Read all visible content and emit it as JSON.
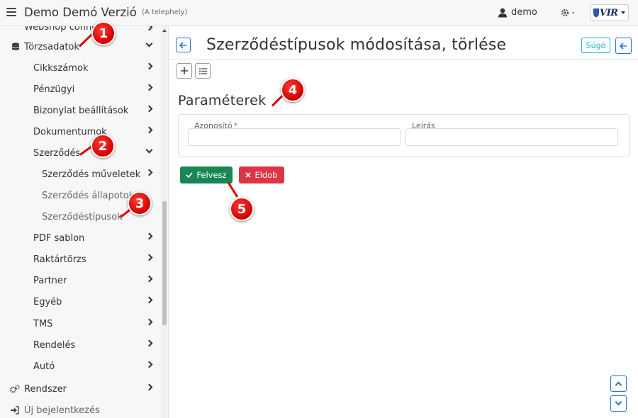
{
  "header": {
    "app_title": "Demo Demó Verzió",
    "location": "(A telephely)",
    "user": "demo",
    "logo_text": "VIR"
  },
  "sidebar": {
    "partial_item": "Webshop conne...",
    "items": [
      {
        "label": "Törzsadatok",
        "level": 0,
        "state": "expanded"
      },
      {
        "label": "Cikkszámok",
        "level": 1
      },
      {
        "label": "Pénzügyi",
        "level": 1
      },
      {
        "label": "Bizonylat beállítások",
        "level": 1
      },
      {
        "label": "Dokumentumok",
        "level": 1
      },
      {
        "label": "Szerződés",
        "level": 1,
        "state": "expanded"
      },
      {
        "label": "Szerződés műveletek",
        "level": 2
      },
      {
        "label": "Szerződés állapotok",
        "level": 2
      },
      {
        "label": "Szerződéstípusok",
        "level": 2,
        "state": "active"
      },
      {
        "label": "PDF sablon",
        "level": 1
      },
      {
        "label": "Raktártörzs",
        "level": 1
      },
      {
        "label": "Partner",
        "level": 1
      },
      {
        "label": "Egyéb",
        "level": 1
      },
      {
        "label": "TMS",
        "level": 1
      },
      {
        "label": "Rendelés",
        "level": 1
      },
      {
        "label": "Autó",
        "level": 1
      },
      {
        "label": "Rendszer",
        "level": 0
      },
      {
        "label": "Új bejelentkezés",
        "level": 0
      }
    ]
  },
  "main": {
    "page_title": "Szerződéstípusok módosítása, törlése",
    "help_label": "Súgó",
    "section_title": "Paraméterek",
    "fields": [
      {
        "label": "Azonosító",
        "required_mark": "*",
        "value": ""
      },
      {
        "label": "Leírás",
        "value": ""
      }
    ],
    "save_label": "Felvesz",
    "discard_label": "Eldob"
  },
  "annotations": [
    "1",
    "2",
    "3",
    "4",
    "5"
  ],
  "colors": {
    "primary": "#2a6fd6",
    "success": "#198754",
    "danger": "#dc3545",
    "info": "#1eb0d0",
    "badge": "#e00000"
  }
}
